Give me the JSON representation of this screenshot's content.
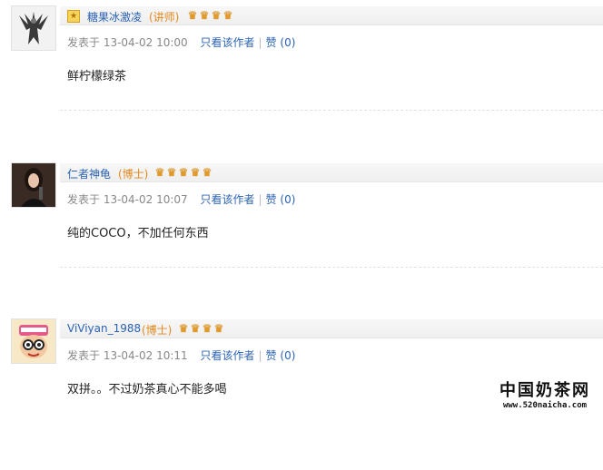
{
  "posts": [
    {
      "username": "糖果冰激凌",
      "rank": "(讲师)",
      "stars": 4,
      "has_vip": true,
      "meta": {
        "posted": "发表于 13-04-02 10:00",
        "only_author": "只看该作者",
        "like": "赞 (0)"
      },
      "content": "鲜柠檬绿茶",
      "avatar_icon": "dragon-avatar"
    },
    {
      "username": "仁者神龟",
      "rank": "(博士)",
      "stars": 5,
      "has_vip": false,
      "meta": {
        "posted": "发表于 13-04-02 10:07",
        "only_author": "只看该作者",
        "like": "赞 (0)"
      },
      "content": "纯的COCO，不加任何东西",
      "avatar_icon": "woman-photo-avatar"
    },
    {
      "username": "ViViyan_1988",
      "rank": "(博士)",
      "stars": 4,
      "has_vip": false,
      "meta": {
        "posted": "发表于 13-04-02 10:11",
        "only_author": "只看该作者",
        "like": "赞 (0)"
      },
      "content": "双拼。。不过奶茶真心不能多喝",
      "avatar_icon": "cartoon-girl-avatar"
    }
  ],
  "watermark": {
    "title": "中国奶茶网",
    "url": "www.520naicha.com"
  },
  "colors": {
    "link": "#2b63b4",
    "rank": "#e3881a",
    "star": "#e89a1d",
    "meta": "#888888"
  }
}
